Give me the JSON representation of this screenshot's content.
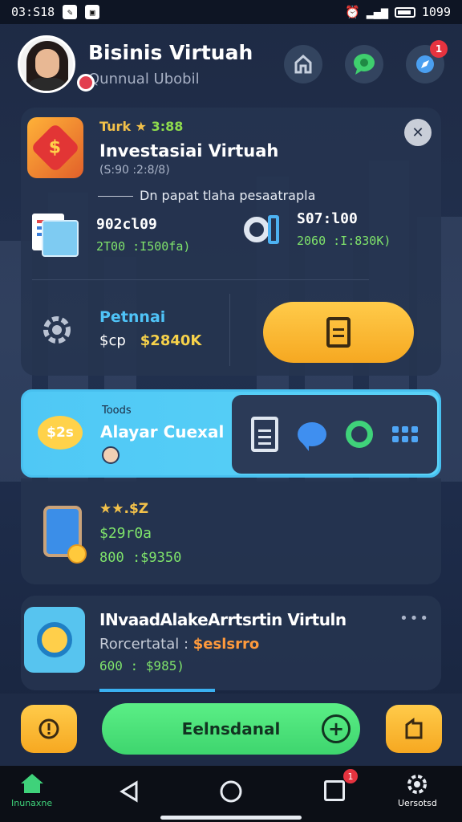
{
  "status": {
    "time": "03:S18",
    "icon1": "tool-icon",
    "icon2": "image-icon",
    "alarm": "alarm-icon",
    "battery_text": "1099"
  },
  "header": {
    "title": "Bisinis Virtuah",
    "subtitle": "Qunnual Ubobil",
    "notif_count": "1",
    "icons": [
      "home-icon",
      "chat-icon",
      "compass-icon"
    ]
  },
  "card1": {
    "rating_label": "Turk ★ ",
    "rating_value": "3:88",
    "title": "Investasiai Virtuah",
    "subtitle": "(S:90 :2:8/8)",
    "description": "Dn papat tlaha pesaatrapla",
    "stat_left": {
      "value": "902cl09",
      "sub": "2T00 :I500fa)"
    },
    "stat_right": {
      "value": "S07:l00",
      "sub": "2060 :I:830K)"
    },
    "potential_label": "Petnnai",
    "potential_prefix": "$cp",
    "potential_value": "$2840K",
    "close_label": "✕"
  },
  "blue_band": {
    "small": "Toods",
    "title": "Alayar Cuexal",
    "bubble": "$2s"
  },
  "card2": {
    "rating": "★★.$Z",
    "value1": "$29r0a",
    "value2": "800 :$9350"
  },
  "card3": {
    "title": "INvaadAlakeArrtsrtin Virtuln",
    "sub_label": "Rorcertatal : ",
    "sub_value": "$eslsrro",
    "value": "600 : $985)",
    "menu": "•••"
  },
  "actionbar": {
    "main_button": "Eelnsdanal",
    "plus": "+"
  },
  "navbar": {
    "home_label": "Inunaxne",
    "settings_label": "Uersotsd",
    "notif_count": "1"
  },
  "colors": {
    "background": "#1b2740",
    "accent_yellow": "#f6a821",
    "accent_green": "#3ed56e",
    "accent_blue": "#4fc8f5"
  }
}
